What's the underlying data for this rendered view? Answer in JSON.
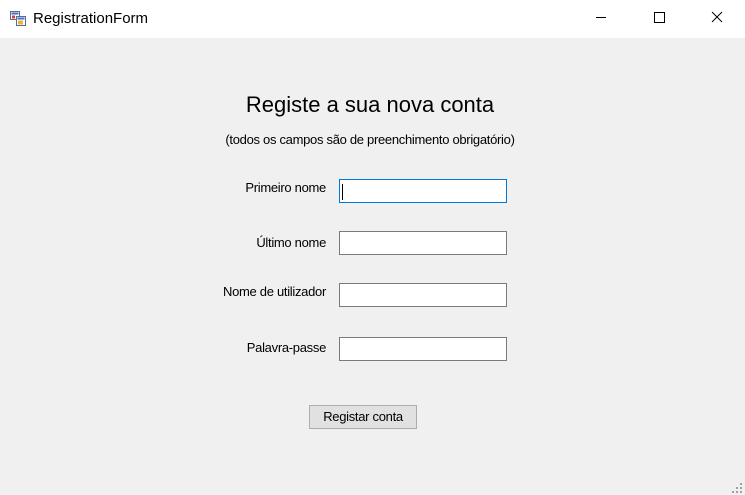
{
  "window": {
    "title": "RegistrationForm",
    "icon": "winforms-app-icon",
    "controls": {
      "minimize": "minimize-icon",
      "maximize": "maximize-icon",
      "close": "close-icon"
    }
  },
  "form": {
    "heading": "Registe a sua nova conta",
    "subheading": "(todos os campos são de preenchimento obrigatório)",
    "fields": [
      {
        "label": "Primeiro nome",
        "value": "",
        "focused": true
      },
      {
        "label": "Último nome",
        "value": ""
      },
      {
        "label": "Nome de utilizador",
        "value": ""
      },
      {
        "label": "Palavra-passe",
        "value": ""
      }
    ],
    "submit_label": "Registar conta"
  },
  "colors": {
    "client_background": "#f0f0f0",
    "titlebar_background": "#ffffff",
    "focus_border": "#0078d7",
    "field_border": "#7a7a7a",
    "button_background": "#e1e1e1",
    "button_border": "#adadad"
  }
}
